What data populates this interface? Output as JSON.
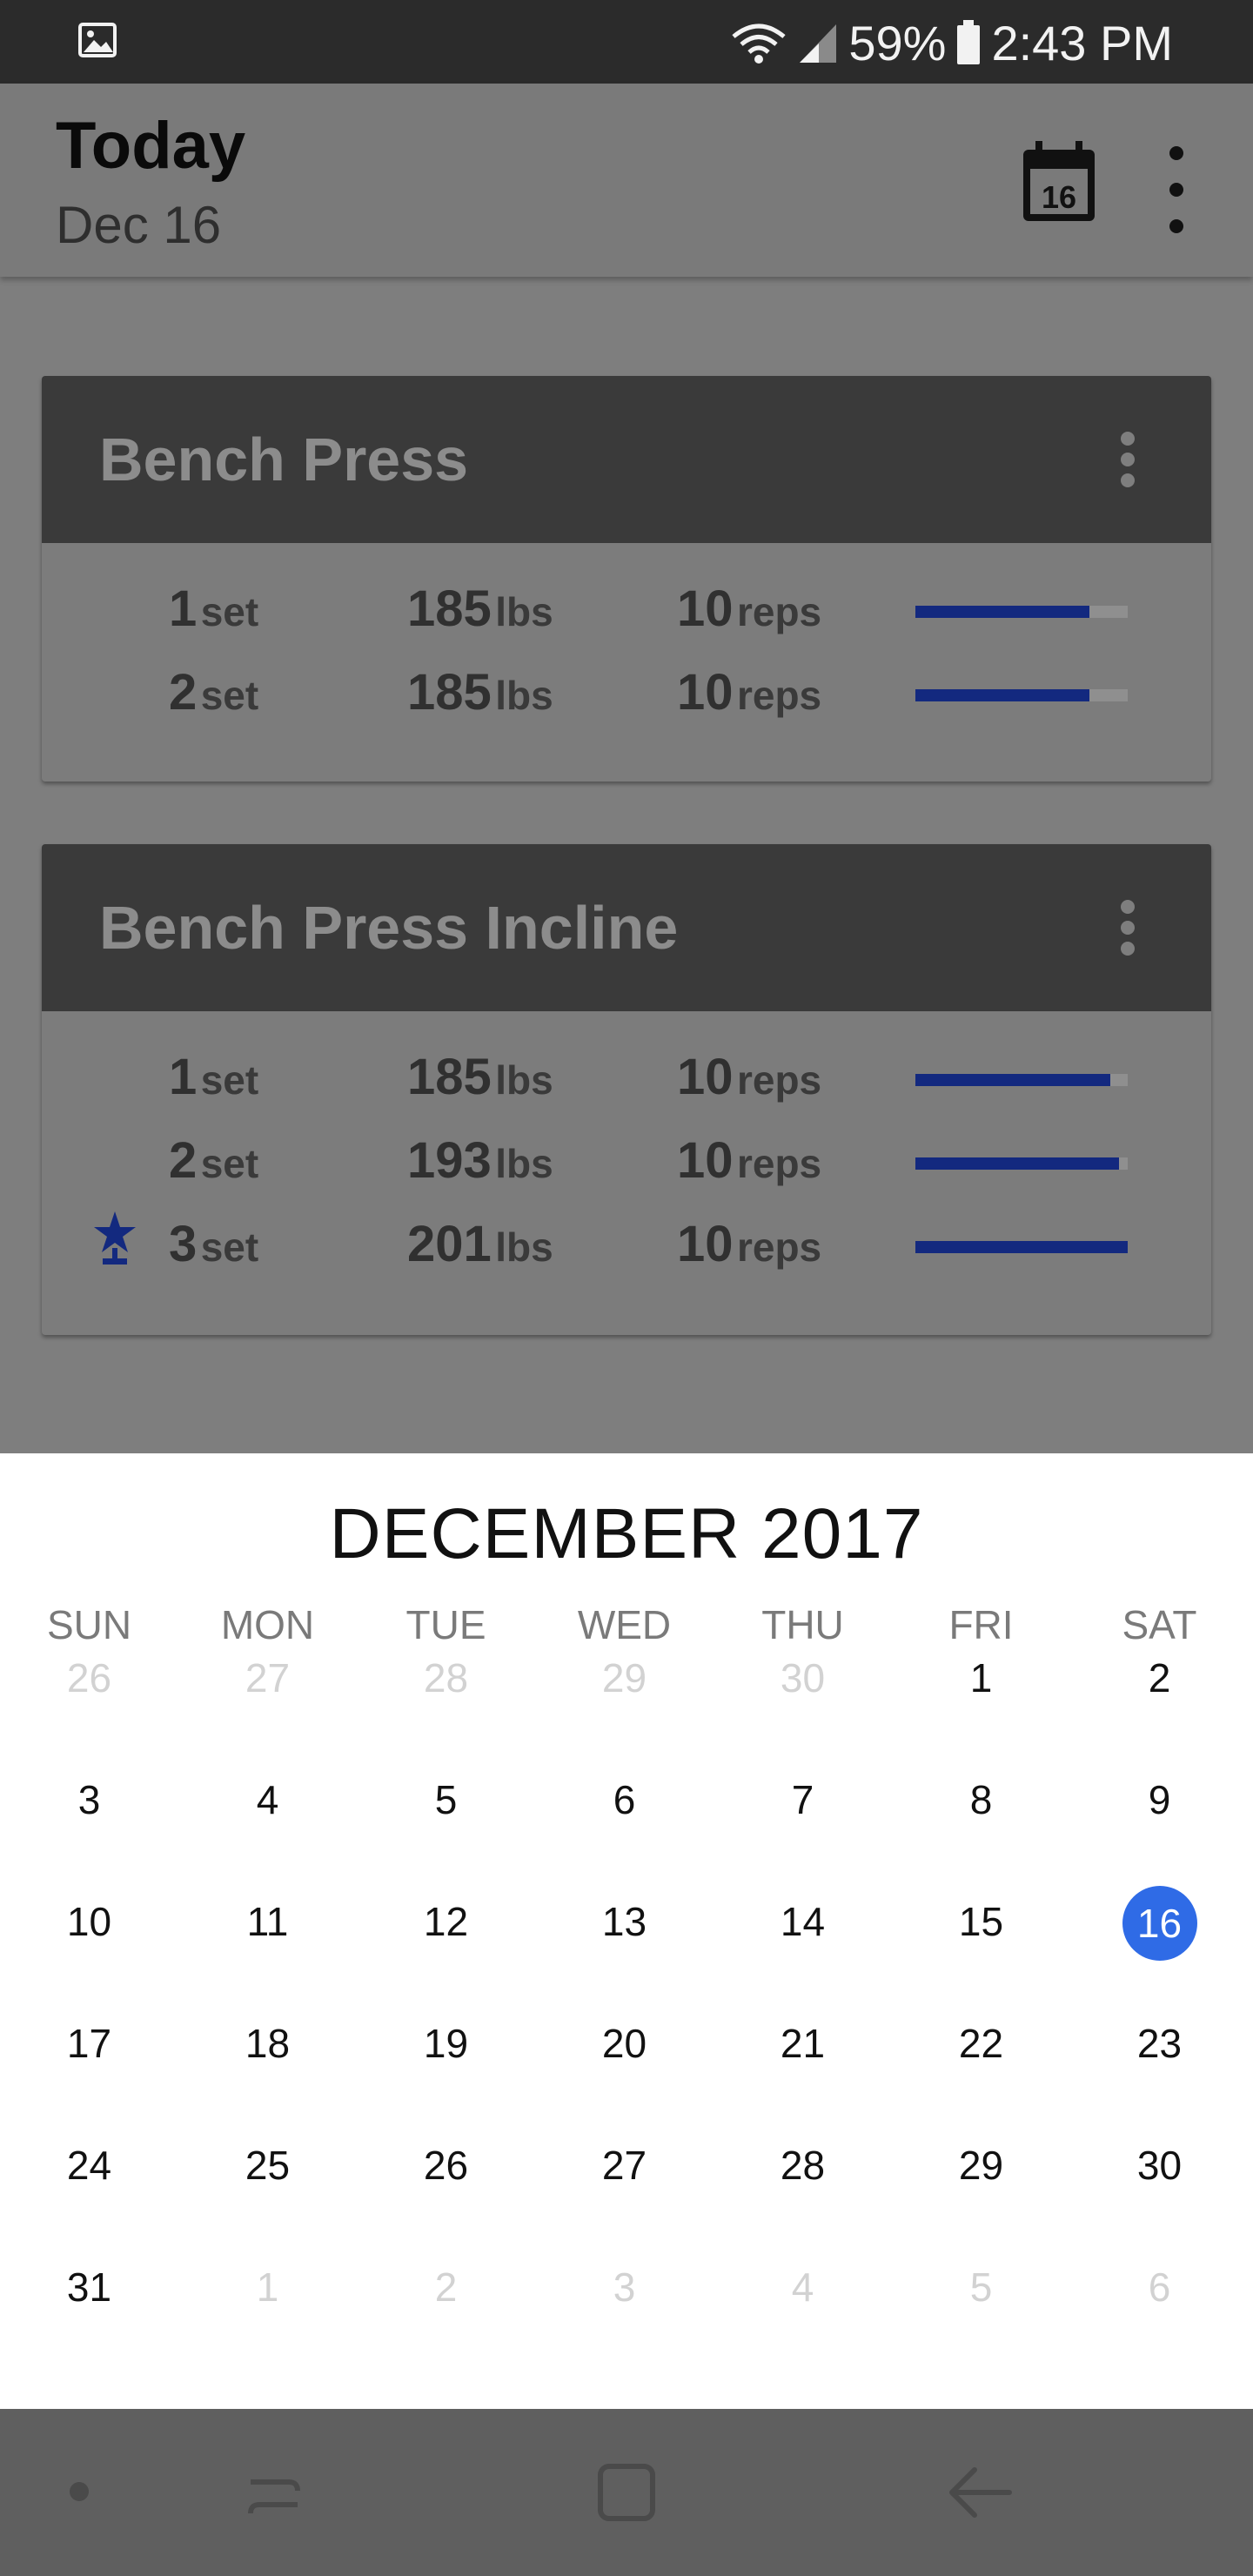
{
  "status_bar": {
    "battery": "59%",
    "time": "2:43 PM",
    "icons": [
      "gallery-icon",
      "wifi-icon",
      "signal-icon",
      "battery-icon"
    ]
  },
  "app_bar": {
    "title": "Today",
    "subtitle": "Dec 16",
    "calendar_icon_day": "16"
  },
  "workouts": [
    {
      "name": "Bench Press",
      "sets": [
        {
          "set": "1",
          "set_unit": "set",
          "weight": "185",
          "weight_unit": "lbs",
          "reps": "10",
          "reps_unit": "reps",
          "progress": 0.82,
          "record": false
        },
        {
          "set": "2",
          "set_unit": "set",
          "weight": "185",
          "weight_unit": "lbs",
          "reps": "10",
          "reps_unit": "reps",
          "progress": 0.82,
          "record": false
        }
      ]
    },
    {
      "name": "Bench Press Incline",
      "sets": [
        {
          "set": "1",
          "set_unit": "set",
          "weight": "185",
          "weight_unit": "lbs",
          "reps": "10",
          "reps_unit": "reps",
          "progress": 0.92,
          "record": false
        },
        {
          "set": "2",
          "set_unit": "set",
          "weight": "193",
          "weight_unit": "lbs",
          "reps": "10",
          "reps_unit": "reps",
          "progress": 0.96,
          "record": false
        },
        {
          "set": "3",
          "set_unit": "set",
          "weight": "201",
          "weight_unit": "lbs",
          "reps": "10",
          "reps_unit": "reps",
          "progress": 1.0,
          "record": true
        }
      ]
    }
  ],
  "calendar": {
    "month_label": "DECEMBER 2017",
    "weekdays": [
      "SUN",
      "MON",
      "TUE",
      "WED",
      "THU",
      "FRI",
      "SAT"
    ],
    "weeks": [
      [
        "26",
        "27",
        "28",
        "29",
        "30",
        "1",
        "2"
      ],
      [
        "3",
        "4",
        "5",
        "6",
        "7",
        "8",
        "9"
      ],
      [
        "10",
        "11",
        "12",
        "13",
        "14",
        "15",
        "16"
      ],
      [
        "17",
        "18",
        "19",
        "20",
        "21",
        "22",
        "23"
      ],
      [
        "24",
        "25",
        "26",
        "27",
        "28",
        "29",
        "30"
      ],
      [
        "31",
        "1",
        "2",
        "3",
        "4",
        "5",
        "6"
      ]
    ],
    "outside_month": [
      [
        0,
        0
      ],
      [
        0,
        1
      ],
      [
        0,
        2
      ],
      [
        0,
        3
      ],
      [
        0,
        4
      ],
      [
        5,
        1
      ],
      [
        5,
        2
      ],
      [
        5,
        3
      ],
      [
        5,
        4
      ],
      [
        5,
        5
      ],
      [
        5,
        6
      ]
    ],
    "selected_day": "16",
    "selected_color": "#2f6be6"
  },
  "colors": {
    "bar_fill": "#13297f",
    "card_header": "#3a3a3a"
  },
  "nav_bar": {
    "icons": [
      "dot-icon",
      "recents-icon",
      "home-icon",
      "back-icon"
    ]
  }
}
